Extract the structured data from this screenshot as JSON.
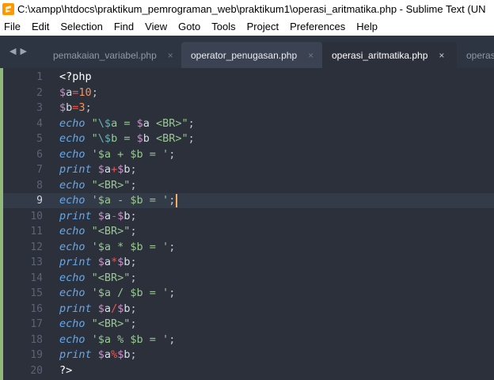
{
  "window": {
    "title": "C:\\xampp\\htdocs\\praktikum_pemrograman_web\\praktikum1\\operasi_aritmatika.php - Sublime Text (UN",
    "app_icon": "sublime-text-icon"
  },
  "menu": [
    "File",
    "Edit",
    "Selection",
    "Find",
    "View",
    "Goto",
    "Tools",
    "Project",
    "Preferences",
    "Help"
  ],
  "tabs": [
    {
      "label": "pemakaian_variabel.php",
      "state": "inactive"
    },
    {
      "label": "operator_penugasan.php",
      "state": "open"
    },
    {
      "label": "operasi_aritmatika.php",
      "state": "current"
    },
    {
      "label": "operasi",
      "state": "inactive"
    }
  ],
  "nav_arrows": "◀ ▶",
  "tab_close_glyph": "×",
  "editor": {
    "current_line": 9,
    "line_numbers": [
      "1",
      "2",
      "3",
      "4",
      "5",
      "6",
      "7",
      "8",
      "9",
      "10",
      "11",
      "12",
      "13",
      "14",
      "15",
      "16",
      "17",
      "18",
      "19",
      "20"
    ],
    "lines": [
      [
        [
          "tag",
          "<?php"
        ]
      ],
      [
        [
          "dollar",
          "$"
        ],
        [
          "var",
          "a"
        ],
        [
          "op",
          "="
        ],
        [
          "num",
          "10"
        ],
        [
          "punc",
          ";"
        ]
      ],
      [
        [
          "dollar",
          "$"
        ],
        [
          "var",
          "b"
        ],
        [
          "op",
          "="
        ],
        [
          "num",
          "3"
        ],
        [
          "punc",
          ";"
        ]
      ],
      [
        [
          "kw",
          "echo"
        ],
        [
          "plain",
          " "
        ],
        [
          "str",
          "\""
        ],
        [
          "esc",
          "\\$"
        ],
        [
          "str",
          "a = "
        ],
        [
          "dollar",
          "$"
        ],
        [
          "var",
          "a"
        ],
        [
          "str",
          " <BR>\""
        ],
        [
          "punc",
          ";"
        ]
      ],
      [
        [
          "kw",
          "echo"
        ],
        [
          "plain",
          " "
        ],
        [
          "str",
          "\""
        ],
        [
          "esc",
          "\\$"
        ],
        [
          "str",
          "b = "
        ],
        [
          "dollar",
          "$"
        ],
        [
          "var",
          "b"
        ],
        [
          "str",
          " <BR>\""
        ],
        [
          "punc",
          ";"
        ]
      ],
      [
        [
          "kw",
          "echo"
        ],
        [
          "plain",
          " "
        ],
        [
          "str",
          "'$a + $b = '"
        ],
        [
          "punc",
          ";"
        ]
      ],
      [
        [
          "kw",
          "print"
        ],
        [
          "plain",
          " "
        ],
        [
          "dollar",
          "$"
        ],
        [
          "var",
          "a"
        ],
        [
          "op",
          "+"
        ],
        [
          "dollar",
          "$"
        ],
        [
          "var",
          "b"
        ],
        [
          "punc",
          ";"
        ]
      ],
      [
        [
          "kw",
          "echo"
        ],
        [
          "plain",
          " "
        ],
        [
          "str",
          "\"<BR>\""
        ],
        [
          "punc",
          ";"
        ]
      ],
      [
        [
          "kw",
          "echo"
        ],
        [
          "plain",
          " "
        ],
        [
          "str",
          "'$a - $b = '"
        ],
        [
          "punc",
          ";"
        ],
        [
          "caret",
          ""
        ]
      ],
      [
        [
          "kw",
          "print"
        ],
        [
          "plain",
          " "
        ],
        [
          "dollar",
          "$"
        ],
        [
          "var",
          "a"
        ],
        [
          "op",
          "-"
        ],
        [
          "dollar",
          "$"
        ],
        [
          "var",
          "b"
        ],
        [
          "punc",
          ";"
        ]
      ],
      [
        [
          "kw",
          "echo"
        ],
        [
          "plain",
          " "
        ],
        [
          "str",
          "\"<BR>\""
        ],
        [
          "punc",
          ";"
        ]
      ],
      [
        [
          "kw",
          "echo"
        ],
        [
          "plain",
          " "
        ],
        [
          "str",
          "'$a * $b = '"
        ],
        [
          "punc",
          ";"
        ]
      ],
      [
        [
          "kw",
          "print"
        ],
        [
          "plain",
          " "
        ],
        [
          "dollar",
          "$"
        ],
        [
          "var",
          "a"
        ],
        [
          "op",
          "*"
        ],
        [
          "dollar",
          "$"
        ],
        [
          "var",
          "b"
        ],
        [
          "punc",
          ";"
        ]
      ],
      [
        [
          "kw",
          "echo"
        ],
        [
          "plain",
          " "
        ],
        [
          "str",
          "\"<BR>\""
        ],
        [
          "punc",
          ";"
        ]
      ],
      [
        [
          "kw",
          "echo"
        ],
        [
          "plain",
          " "
        ],
        [
          "str",
          "'$a / $b = '"
        ],
        [
          "punc",
          ";"
        ]
      ],
      [
        [
          "kw",
          "print"
        ],
        [
          "plain",
          " "
        ],
        [
          "dollar",
          "$"
        ],
        [
          "var",
          "a"
        ],
        [
          "op",
          "/"
        ],
        [
          "dollar",
          "$"
        ],
        [
          "var",
          "b"
        ],
        [
          "punc",
          ";"
        ]
      ],
      [
        [
          "kw",
          "echo"
        ],
        [
          "plain",
          " "
        ],
        [
          "str",
          "\"<BR>\""
        ],
        [
          "punc",
          ";"
        ]
      ],
      [
        [
          "kw",
          "echo"
        ],
        [
          "plain",
          " "
        ],
        [
          "str",
          "'$a % $b = '"
        ],
        [
          "punc",
          ";"
        ]
      ],
      [
        [
          "kw",
          "print"
        ],
        [
          "plain",
          " "
        ],
        [
          "dollar",
          "$"
        ],
        [
          "var",
          "a"
        ],
        [
          "op",
          "%"
        ],
        [
          "dollar",
          "$"
        ],
        [
          "var",
          "b"
        ],
        [
          "punc",
          ";"
        ]
      ],
      [
        [
          "tag",
          "?>"
        ]
      ]
    ]
  },
  "colors": {
    "editor_bg": "#2b303b",
    "tab_bar_bg": "#2e3542",
    "modified_marker": "#8fb879",
    "caret": "#f9ae58"
  }
}
